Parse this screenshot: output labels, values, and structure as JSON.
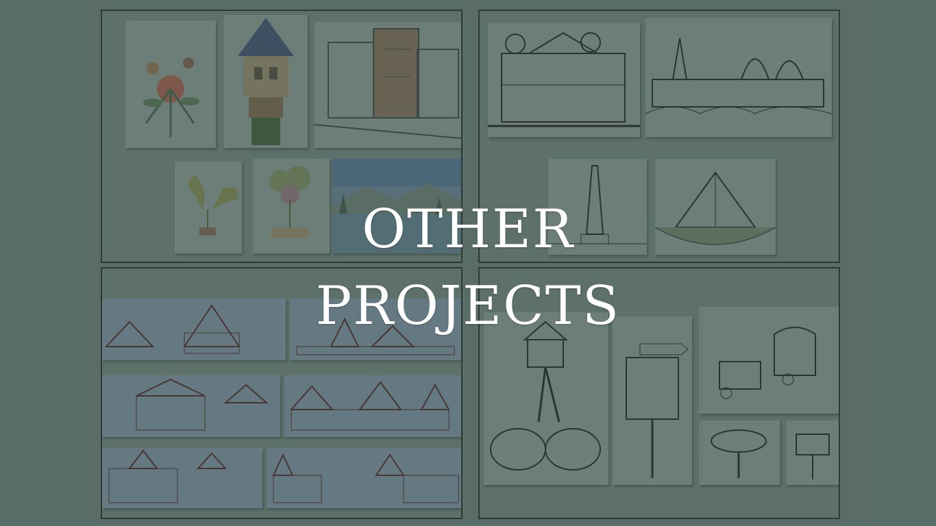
{
  "heading": {
    "line1": "OTHER",
    "line2": "PROJECTS"
  },
  "panels": [
    {
      "id": "illustrations",
      "cards": [
        "floral-bouquet",
        "fairytale-tower",
        "modern-house",
        "taro-plant",
        "potted-plant",
        "lake-landscape"
      ]
    },
    {
      "id": "architecture-sketches",
      "cards": [
        "palace-sketch",
        "domed-city-sketch",
        "obelisk-sketch",
        "pyramid-sketch"
      ]
    },
    {
      "id": "elevation-drawings",
      "cards": [
        "elevation-row-1a",
        "elevation-row-1b",
        "elevation-row-2a",
        "elevation-row-2b",
        "elevation-row-3a",
        "elevation-row-3b"
      ]
    },
    {
      "id": "theme-park-sketches",
      "cards": [
        "treehouse-sketch",
        "signpost-sketch",
        "wagon-sketch",
        "mushroom-sign-sketch",
        "tour-safari-sign-sketch"
      ]
    }
  ],
  "colors": {
    "background": "#5d716b",
    "panel_border": "#26332f",
    "title": "#ffffff"
  }
}
